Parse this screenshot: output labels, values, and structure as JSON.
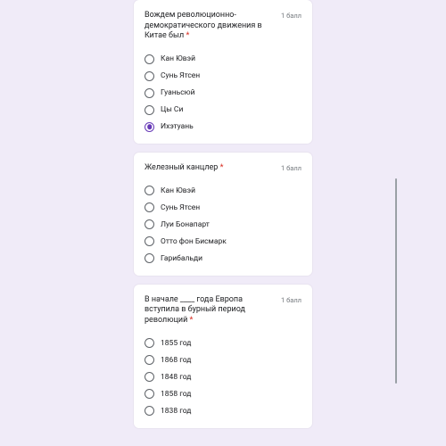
{
  "points_label": "1 балл",
  "required_mark": "*",
  "questions": [
    {
      "title": "Вождем революционно-демократического движения в Китае был",
      "options": [
        {
          "label": "Кан Ювэй",
          "selected": false
        },
        {
          "label": "Сунь Ятсен",
          "selected": false
        },
        {
          "label": "Гуаньсюй",
          "selected": false
        },
        {
          "label": "Цы Си",
          "selected": false
        },
        {
          "label": "Ихэтуань",
          "selected": true
        }
      ]
    },
    {
      "title": "Железный канцлер",
      "options": [
        {
          "label": "Кан Ювэй",
          "selected": false
        },
        {
          "label": "Сунь Ятсен",
          "selected": false
        },
        {
          "label": "Луи Бонапарт",
          "selected": false
        },
        {
          "label": "Отто фон Бисмарк",
          "selected": false
        },
        {
          "label": "Гарибальди",
          "selected": false
        }
      ]
    },
    {
      "title": "В начале ____ года Европа вступила в бурный период революций",
      "options": [
        {
          "label": "1855 год",
          "selected": false
        },
        {
          "label": "1868 год",
          "selected": false
        },
        {
          "label": "1848 год",
          "selected": false
        },
        {
          "label": "1858 год",
          "selected": false
        },
        {
          "label": "1838 год",
          "selected": false
        }
      ]
    }
  ]
}
